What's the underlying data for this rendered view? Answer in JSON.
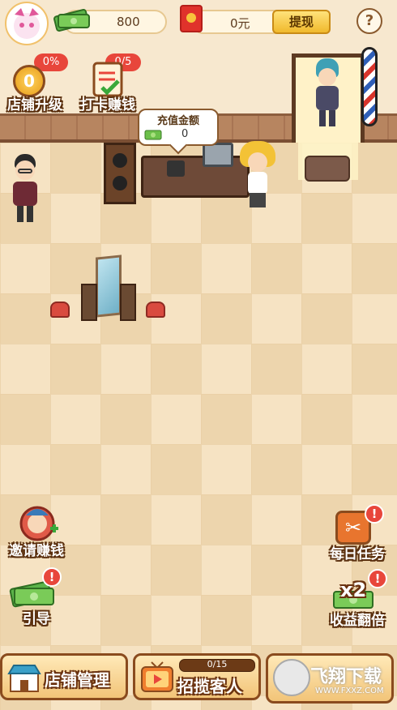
{
  "topbar": {
    "coins": "800",
    "money": "0元",
    "withdraw_label": "提现",
    "help_label": "?"
  },
  "left_buttons": [
    {
      "label": "店铺升级",
      "badge": "0%",
      "level": "0",
      "icon": "shop-upgrade-icon"
    },
    {
      "label": "打卡赚钱",
      "badge": "0/5",
      "icon": "checkin-clipboard-icon"
    },
    {
      "label": "邀请赚钱",
      "icon": "invite-character-icon"
    },
    {
      "label": "引导",
      "alert": "!",
      "icon": "cash-stack-icon"
    }
  ],
  "right_buttons": [
    {
      "label": "每日任务",
      "alert": "!",
      "icon": "scissors-icon"
    },
    {
      "label": "收益翻倍",
      "alert": "!",
      "multiplier": "x2",
      "icon": "cash-stack-icon"
    }
  ],
  "bubble": {
    "title": "充值金额",
    "value": "0"
  },
  "bottom": {
    "manage_label": "店铺管理",
    "recruit_label": "招揽客人",
    "recruit_progress_text": "0/15",
    "recruit_progress": 0
  },
  "watermark": {
    "text": "飞翔下载",
    "url": "WWW.FXXZ.COM"
  },
  "colors": {
    "accent": "#f0b92c",
    "alert": "#e8463b",
    "wood": "#8a4b1e"
  }
}
